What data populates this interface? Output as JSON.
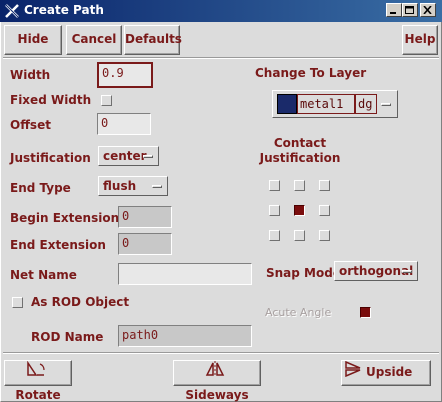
{
  "window": {
    "title": "Create Path"
  },
  "toolbar": {
    "hide": "Hide",
    "cancel": "Cancel",
    "defaults": "Defaults",
    "help": "Help"
  },
  "form": {
    "width_label": "Width",
    "width_value": "0.9",
    "fixed_width_label": "Fixed Width",
    "fixed_width_checked": false,
    "offset_label": "Offset",
    "offset_value": "0",
    "justification_label": "Justification",
    "justification_value": "center",
    "end_type_label": "End Type",
    "end_type_value": "flush",
    "begin_ext_label": "Begin Extension",
    "begin_ext_value": "0",
    "end_ext_label": "End Extension",
    "end_ext_value": "0",
    "net_name_label": "Net Name",
    "net_name_value": "",
    "as_rod_label": "As ROD Object",
    "as_rod_checked": false,
    "rod_name_label": "ROD Name",
    "rod_name_value": "path0"
  },
  "layer": {
    "label": "Change To Layer",
    "name": "metal1",
    "purpose": "dg",
    "swatch_color": "#1a2a6a"
  },
  "contact": {
    "label": "Contact Justification",
    "selected": "center"
  },
  "snap": {
    "label": "Snap Mode",
    "value": "orthogonal"
  },
  "acute": {
    "label": "Acute Angle",
    "checked": true
  },
  "bottom": {
    "rotate": "Rotate",
    "sideways": "Sideways",
    "upside": "Upside Dow"
  },
  "colors": {
    "accent": "#7a1a1a",
    "titlebar": "#0a246a",
    "background": "#dcdcdc"
  }
}
